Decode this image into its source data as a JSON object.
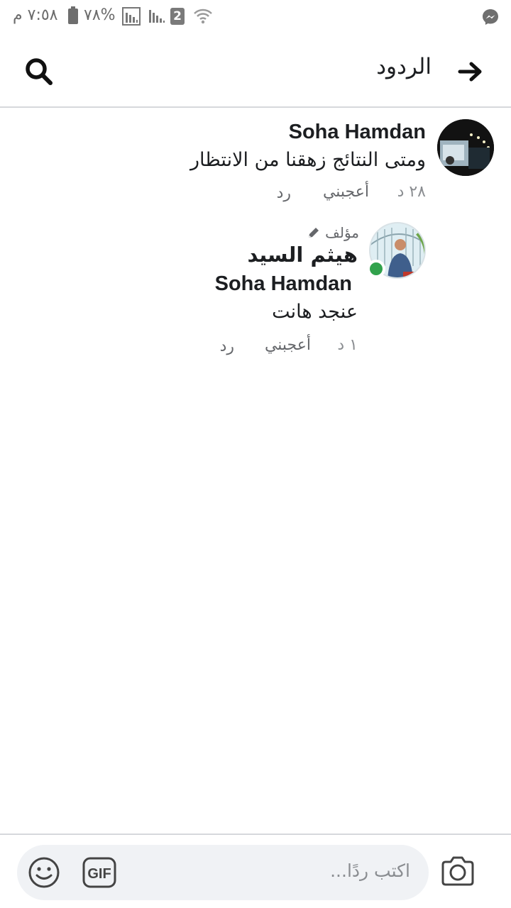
{
  "status_bar": {
    "time": "٧:٥٨ م",
    "battery_percent": "%٧٨",
    "sim_slot": "2"
  },
  "header": {
    "title": "الردود"
  },
  "comment": {
    "author": "Soha Hamdan",
    "text": "ومتى النتائج زهقنا من الانتظار",
    "time": "٢٨ د",
    "like_label": "أعجبني",
    "reply_label": "رد"
  },
  "reply": {
    "author_badge": "مؤلف",
    "author": "هيثم السيد",
    "mention": "Soha Hamdan",
    "text": "عنجد هانت",
    "time": "١ د",
    "like_label": "أعجبني",
    "reply_label": "رد"
  },
  "composer": {
    "placeholder": "اكتب ردًا..."
  },
  "icons": {
    "back": "arrow-right-icon",
    "search": "search-icon",
    "emoji": "emoji-icon",
    "gif": "gif-icon",
    "camera": "camera-icon",
    "messenger": "messenger-icon",
    "author_badge": "pencil-icon"
  },
  "colors": {
    "online": "#31a24c",
    "input_bg": "#f0f2f5",
    "meta_text": "#8a8d91"
  }
}
